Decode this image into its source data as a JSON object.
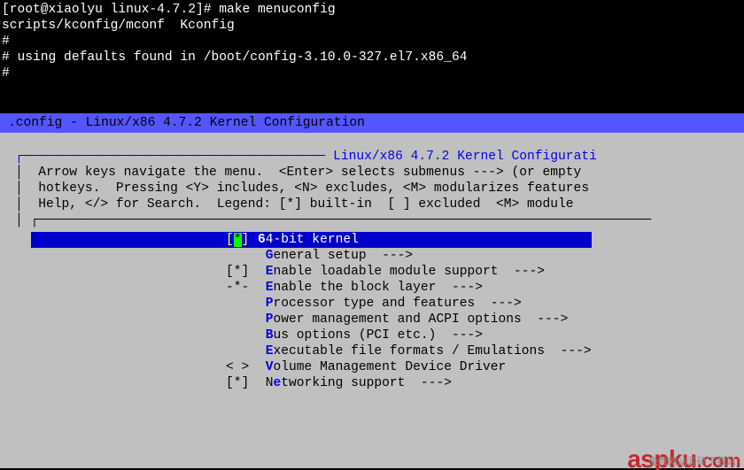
{
  "terminal": {
    "prompt_user": "root@xiaolyu",
    "prompt_path": "linux-4.7.2",
    "command": "make menuconfig",
    "out_line1": "scripts/kconfig/mconf  Kconfig",
    "out_hash1": "#",
    "out_line2": "# using defaults found in /boot/config-3.10.0-327.el7.x86_64",
    "out_hash2": "#"
  },
  "titlebar": {
    "text": ".config - Linux/x86 4.7.2 Kernel Configuration"
  },
  "dialog": {
    "title": "Linux/x86 4.7.2 Kernel Configurati",
    "instr1": "Arrow keys navigate the menu.  <Enter> selects submenus ---> (or empty ",
    "instr2": "hotkeys.  Pressing <Y> includes, <N> excludes, <M> modularizes features",
    "instr3": "Help, </> for Search.  Legend: [*] built-in  [ ] excluded  <M> module  "
  },
  "menu": {
    "items": [
      {
        "col1": "[*]",
        "star": "*",
        "hot": "6",
        "label": "4-bit kernel",
        "arrow": "",
        "selected": true
      },
      {
        "col1": "   ",
        "hot": "G",
        "label": "eneral setup  --->",
        "arrow": ""
      },
      {
        "col1": "[*]",
        "hot": "E",
        "label": "nable loadable module support  --->",
        "arrow": ""
      },
      {
        "col1": "-*-",
        "hot": "E",
        "label": "nable the block layer  --->",
        "arrow": ""
      },
      {
        "col1": "   ",
        "hot": "P",
        "label": "rocessor type and features  --->",
        "arrow": ""
      },
      {
        "col1": "   ",
        "hot": "P",
        "label": "ower management and ACPI options  --->",
        "arrow": ""
      },
      {
        "col1": "   ",
        "hot": "B",
        "label": "us options (PCI etc.)  --->",
        "arrow": ""
      },
      {
        "col1": "   ",
        "hot": "E",
        "label": "xecutable file formats / Emulations  --->",
        "arrow": ""
      },
      {
        "col1": "< >",
        "hot": "V",
        "label": "olume Management Device Driver",
        "arrow": ""
      },
      {
        "col1": "[*]",
        "hot": "N",
        "hot2": "e",
        "label": "tworking support  --->",
        "prefix": "N",
        "arrow": ""
      }
    ]
  },
  "watermark": {
    "main": "aspku",
    "ext": ".com",
    "sub": "免费网站源码下载站!"
  }
}
